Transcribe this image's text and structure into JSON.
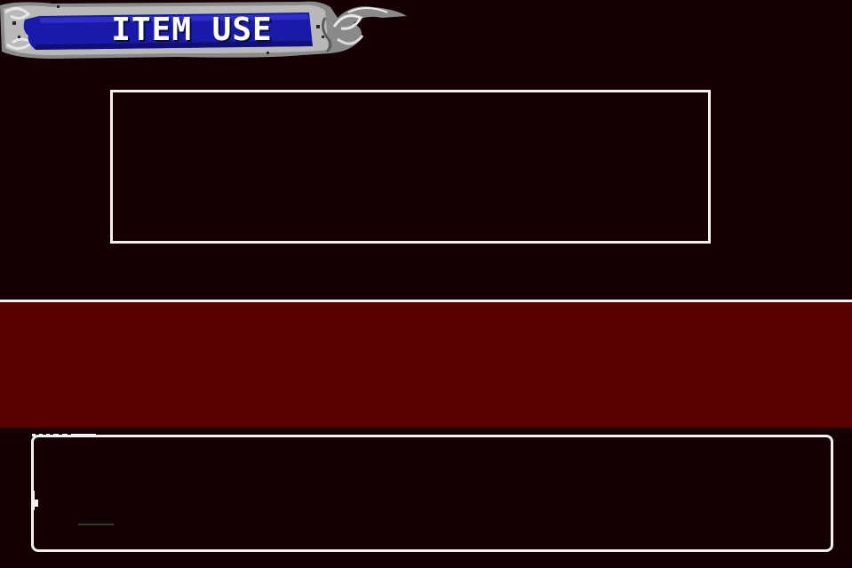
{
  "screen": {
    "title": "ITEM USE"
  },
  "icons": {
    "banner_ornament": "dragon-ornament-icon",
    "cursor": "cursor-icon"
  },
  "colors": {
    "background": "#140004",
    "band": "#570000",
    "banner_blue": "#1a1aa8",
    "border": "#f4f0f0",
    "text": "#ffffff"
  }
}
